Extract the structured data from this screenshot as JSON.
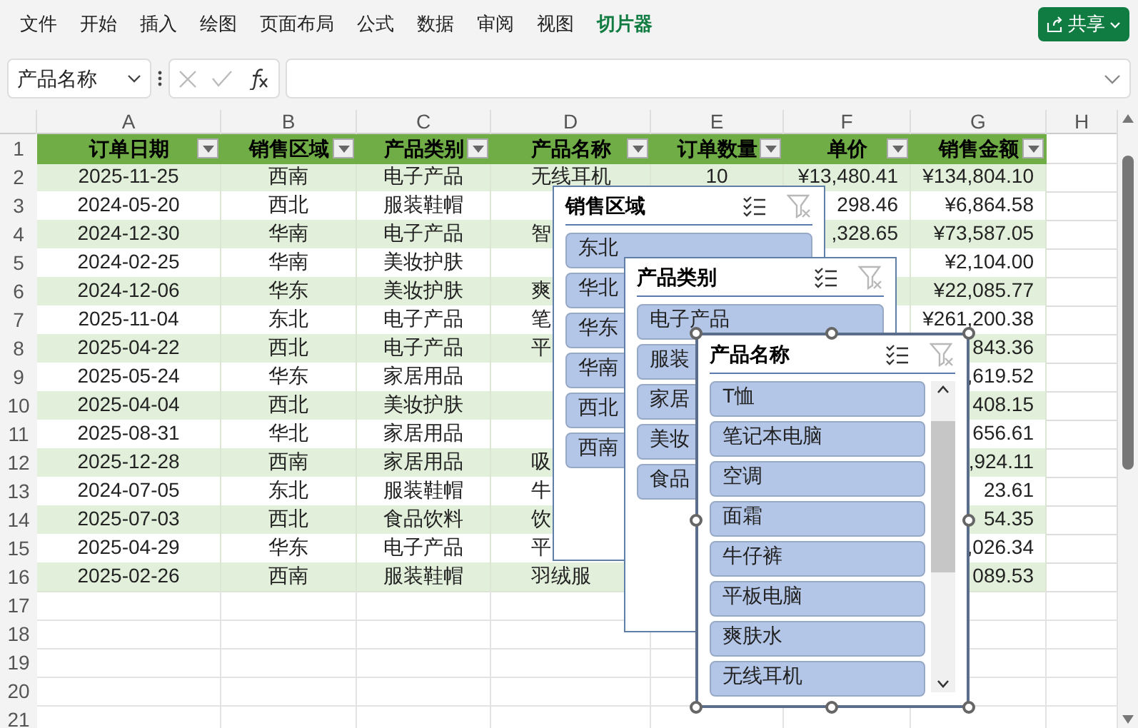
{
  "menu": [
    {
      "label": "文件",
      "selected": false
    },
    {
      "label": "开始",
      "selected": false
    },
    {
      "label": "插入",
      "selected": false
    },
    {
      "label": "绘图",
      "selected": false
    },
    {
      "label": "页面布局",
      "selected": false
    },
    {
      "label": "公式",
      "selected": false
    },
    {
      "label": "数据",
      "selected": false
    },
    {
      "label": "审阅",
      "selected": false
    },
    {
      "label": "视图",
      "selected": false
    },
    {
      "label": "切片器",
      "selected": true
    }
  ],
  "share_button": "共享",
  "name_box": "产品名称",
  "columns": [
    "A",
    "B",
    "C",
    "D",
    "E",
    "F",
    "G",
    "H"
  ],
  "header": {
    "row": "1",
    "cells": [
      "订单日期",
      "销售区域",
      "产品类别",
      "产品名称",
      "订单数量",
      "单价",
      "销售金额"
    ]
  },
  "rows": [
    {
      "row": "2",
      "date": "2025-11-25",
      "region": "西南",
      "category": "电子产品",
      "product": "无线耳机",
      "quantity": "10",
      "unit_price": "¥13,480.41",
      "sales_amount": "¥134,804.10"
    },
    {
      "row": "3",
      "date": "2024-05-20",
      "region": "西北",
      "category": "服装鞋帽",
      "unit_price": "298.46",
      "sales_amount": "¥6,864.58"
    },
    {
      "row": "4",
      "date": "2024-12-30",
      "region": "华南",
      "category": "电子产品",
      "product": "智",
      "unit_price": ",328.65",
      "sales_amount": "¥73,587.05"
    },
    {
      "row": "5",
      "date": "2024-02-25",
      "region": "华南",
      "category": "美妆护肤",
      "sales_amount": "¥2,104.00"
    },
    {
      "row": "6",
      "date": "2024-12-06",
      "region": "华东",
      "category": "美妆护肤",
      "product": "爽",
      "sales_amount": "¥22,085.77"
    },
    {
      "row": "7",
      "date": "2025-11-04",
      "region": "东北",
      "category": "电子产品",
      "product": "笔",
      "sales_amount": "¥261,200.38"
    },
    {
      "row": "8",
      "date": "2025-04-22",
      "region": "西北",
      "category": "电子产品",
      "product": "平",
      "sales_amount": "843.36"
    },
    {
      "row": "9",
      "date": "2025-05-24",
      "region": "华东",
      "category": "家居用品",
      "sales_amount": ",619.52"
    },
    {
      "row": "10",
      "date": "2025-04-04",
      "region": "西北",
      "category": "美妆护肤",
      "sales_amount": "408.15"
    },
    {
      "row": "11",
      "date": "2025-08-31",
      "region": "华北",
      "category": "家居用品",
      "sales_amount": "656.61"
    },
    {
      "row": "12",
      "date": "2025-12-28",
      "region": "西南",
      "category": "家居用品",
      "product": "吸",
      "sales_amount": ",924.11"
    },
    {
      "row": "13",
      "date": "2024-07-05",
      "region": "东北",
      "category": "服装鞋帽",
      "product": "牛",
      "sales_amount": "23.61"
    },
    {
      "row": "14",
      "date": "2025-07-03",
      "region": "西北",
      "category": "食品饮料",
      "product": "饮",
      "sales_amount": "54.35"
    },
    {
      "row": "15",
      "date": "2025-04-29",
      "region": "华东",
      "category": "电子产品",
      "product": "平",
      "sales_amount": ",026.34"
    },
    {
      "row": "16",
      "date": "2025-02-26",
      "region": "西南",
      "category": "服装鞋帽",
      "product": "羽绒服",
      "sales_amount": "089.53"
    }
  ],
  "empty_rows": [
    "17",
    "18",
    "19",
    "20",
    "21"
  ],
  "slicers": [
    {
      "title": "销售区域",
      "selected": false,
      "items": [
        {
          "label": "东北",
          "selected": true
        },
        {
          "label": "华北",
          "selected": true
        },
        {
          "label": "华东",
          "selected": true
        },
        {
          "label": "华南",
          "selected": true
        },
        {
          "label": "西北",
          "selected": true
        },
        {
          "label": "西南",
          "selected": true
        }
      ]
    },
    {
      "title": "产品类别",
      "selected": false,
      "items": [
        {
          "label": "电子产品",
          "selected": true
        },
        {
          "label": "服装",
          "selected": true
        },
        {
          "label": "家居",
          "selected": true
        },
        {
          "label": "美妆",
          "selected": true
        },
        {
          "label": "食品",
          "selected": true
        }
      ]
    },
    {
      "title": "产品名称",
      "selected": true,
      "items": [
        {
          "label": "T恤",
          "selected": true
        },
        {
          "label": "笔记本电脑",
          "selected": true
        },
        {
          "label": "空调",
          "selected": true
        },
        {
          "label": "面霜",
          "selected": true
        },
        {
          "label": "牛仔裤",
          "selected": true
        },
        {
          "label": "平板电脑",
          "selected": true
        },
        {
          "label": "爽肤水",
          "selected": true
        },
        {
          "label": "无线耳机",
          "selected": true
        }
      ]
    }
  ]
}
